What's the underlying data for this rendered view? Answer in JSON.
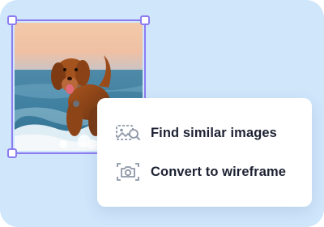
{
  "colors": {
    "background": "#cfe6fb",
    "selection_accent": "#8c7cf0",
    "menu_background": "#ffffff",
    "text": "#1d2233",
    "icon": "#8e97a8"
  },
  "image": {
    "subject": "dog-running-on-beach"
  },
  "context_menu": {
    "items": [
      {
        "icon": "image-search-icon",
        "label": "Find similar images"
      },
      {
        "icon": "camera-scan-icon",
        "label": "Convert to wireframe"
      }
    ]
  }
}
